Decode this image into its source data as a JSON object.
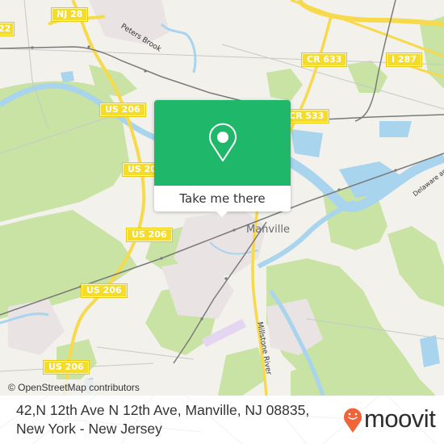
{
  "map": {
    "colors": {
      "land": "#f2f1ec",
      "park": "#c9e3a4",
      "water": "#a9d4ee",
      "residential": "#e9e4e3",
      "highway": "#f7d94c",
      "rail": "#7a7a7a",
      "accent": "#1fb76a"
    },
    "road_shields": [
      {
        "id": "nj28",
        "label": "NJ 28"
      },
      {
        "id": "us22",
        "label": "22"
      },
      {
        "id": "us206-a",
        "label": "US 206"
      },
      {
        "id": "us206-b",
        "label": "US 206"
      },
      {
        "id": "us206-c",
        "label": "US 206"
      },
      {
        "id": "us206-d",
        "label": "US 206"
      },
      {
        "id": "us206-e",
        "label": "US 206"
      },
      {
        "id": "cr633",
        "label": "CR 633"
      },
      {
        "id": "cr533",
        "label": "CR 533"
      },
      {
        "id": "i287",
        "label": "I 287"
      }
    ],
    "labels": {
      "town": "Manville",
      "peters_brook": "Peters Brook",
      "millstone_river": "Millstone River",
      "delaware_canal": "Delaware an"
    },
    "attribution": "© OpenStreetMap contributors"
  },
  "popup": {
    "icon": "location-pin-icon",
    "button_label": "Take me there"
  },
  "footer": {
    "address": "42,N 12th Ave N 12th Ave, Manville, NJ 08835, New York - New Jersey",
    "brand": "moovit",
    "brand_color": "#f0643a"
  }
}
